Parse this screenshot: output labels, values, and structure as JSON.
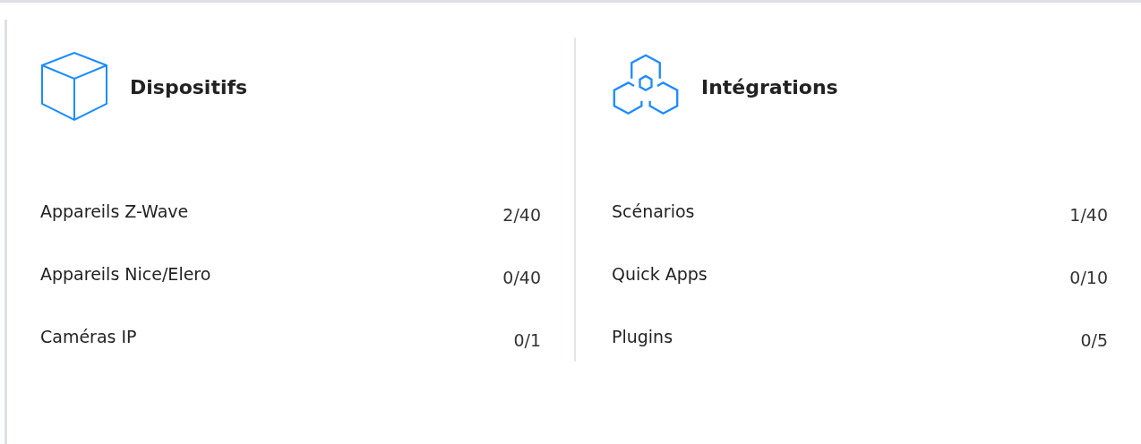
{
  "sections": [
    {
      "title": "Dispositifs",
      "rows": [
        {
          "label": "Appareils Z-Wave",
          "value": "2/40"
        },
        {
          "label": "Appareils Nice/Elero",
          "value": "0/40"
        },
        {
          "label": "Caméras IP",
          "value": "0/1"
        }
      ]
    },
    {
      "title": "Intégrations",
      "rows": [
        {
          "label": "Scénarios",
          "value": "1/40"
        },
        {
          "label": "Quick Apps",
          "value": "0/10"
        },
        {
          "label": "Plugins",
          "value": "0/5"
        }
      ]
    }
  ]
}
